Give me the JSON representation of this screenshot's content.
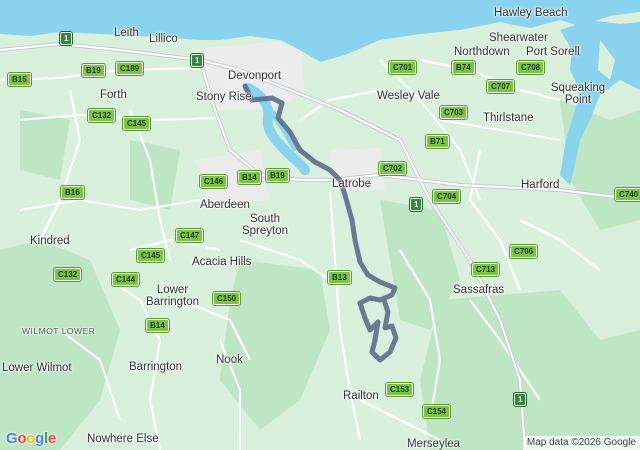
{
  "places": {
    "hawley_beach": "Hawley Beach",
    "leith": "Leith",
    "lillico": "Lillico",
    "shearwater": "Shearwater",
    "northdown": "Northdown",
    "port_sorell": "Port Sorell",
    "devonport": "Devonport",
    "forth": "Forth",
    "stony_rise": "Stony Rise",
    "wesley_vale": "Wesley Vale",
    "squeaking_point": "Squeaking Point",
    "thirlstane": "Thirlstane",
    "latrobe": "Latrobe",
    "harford": "Harford",
    "aberdeen": "Aberdeen",
    "south_spreyton": "South Spreyton",
    "kindred": "Kindred",
    "acacia_hills": "Acacia Hills",
    "sassafras": "Sassafras",
    "lower_barrington": "Lower Barrington",
    "wilmot_lower": "WILMOT LOWER",
    "nook": "Nook",
    "lower_wilmot": "Lower Wilmot",
    "barrington": "Barrington",
    "railton": "Railton",
    "nowhere_else": "Nowhere Else",
    "merseylea": "Merseylea"
  },
  "routes": {
    "r1a": "1",
    "r1b": "1",
    "r1c": "1",
    "b15": "B15",
    "b19a": "B19",
    "c189": "C189",
    "c132a": "C132",
    "c145a": "C145",
    "b16": "B16",
    "c146": "C146",
    "b14a": "B14",
    "b19b": "B19",
    "c147": "C147",
    "c145b": "C145",
    "c144": "C144",
    "c132b": "C132",
    "c150": "C150",
    "b14b": "B14",
    "b13": "B13",
    "c701": "C701",
    "b74": "B74",
    "c708": "C708",
    "c707": "C707",
    "c703": "C703",
    "b71": "B71",
    "c702": "C702",
    "c704": "C704",
    "c706": "C706",
    "c713": "C713",
    "c740": "C740",
    "c153": "C153",
    "c154": "C154"
  },
  "attribution": "Map data ©2026 Google",
  "logo_letters": [
    "G",
    "o",
    "o",
    "g",
    "l",
    "e"
  ],
  "colors": {
    "water": "#8ad3ef",
    "land": "#d8f0dc",
    "forest": "#bfe6c4",
    "urban": "#ededed",
    "road": "#ffffff",
    "highway": "#c7c7c7",
    "route_line": "#5b6e8c"
  }
}
